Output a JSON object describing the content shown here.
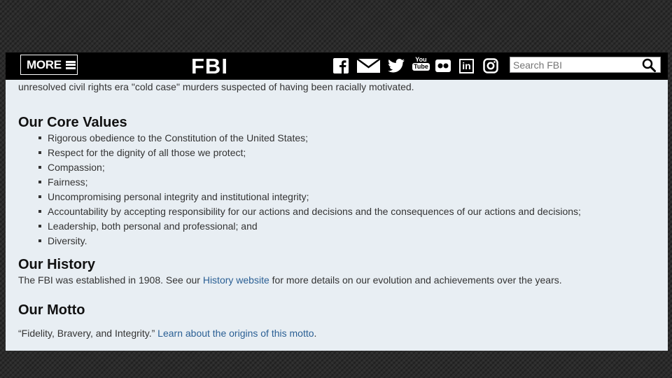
{
  "navbar": {
    "more_label": "MORE",
    "logo": "FBI",
    "search_placeholder": "Search FBI",
    "social_icons": [
      "facebook-icon",
      "email-icon",
      "twitter-icon",
      "youtube-icon",
      "flickr-icon",
      "linkedin-icon",
      "instagram-icon"
    ],
    "youtube_top": "You",
    "youtube_bottom": "Tube",
    "linkedin_text": "in"
  },
  "content": {
    "truncated_line": "unresolved civil rights era \"cold case\" murders suspected of having been racially motivated.",
    "core_values": {
      "heading": "Our Core Values",
      "items": [
        "Rigorous obedience to the Constitution of the United States;",
        "Respect for the dignity of all those we protect;",
        "Compassion;",
        "Fairness;",
        "Uncompromising personal integrity and institutional integrity;",
        "Accountability by accepting responsibility for our actions and decisions and the consequences of our actions and decisions;",
        "Leadership, both personal and professional; and",
        "Diversity."
      ]
    },
    "history": {
      "heading": "Our History",
      "text_before": "The FBI was established in 1908. See our ",
      "link": "History website",
      "text_after": " for more details on our evolution and achievements over the years."
    },
    "motto": {
      "heading": "Our Motto",
      "quote": "“Fidelity, Bravery, and Integrity.” ",
      "link": "Learn about the origins of this motto",
      "end": "."
    }
  },
  "colors": {
    "navbar_bg": "#000000",
    "page_bg": "#e8eef3",
    "link": "#2a5f94"
  }
}
